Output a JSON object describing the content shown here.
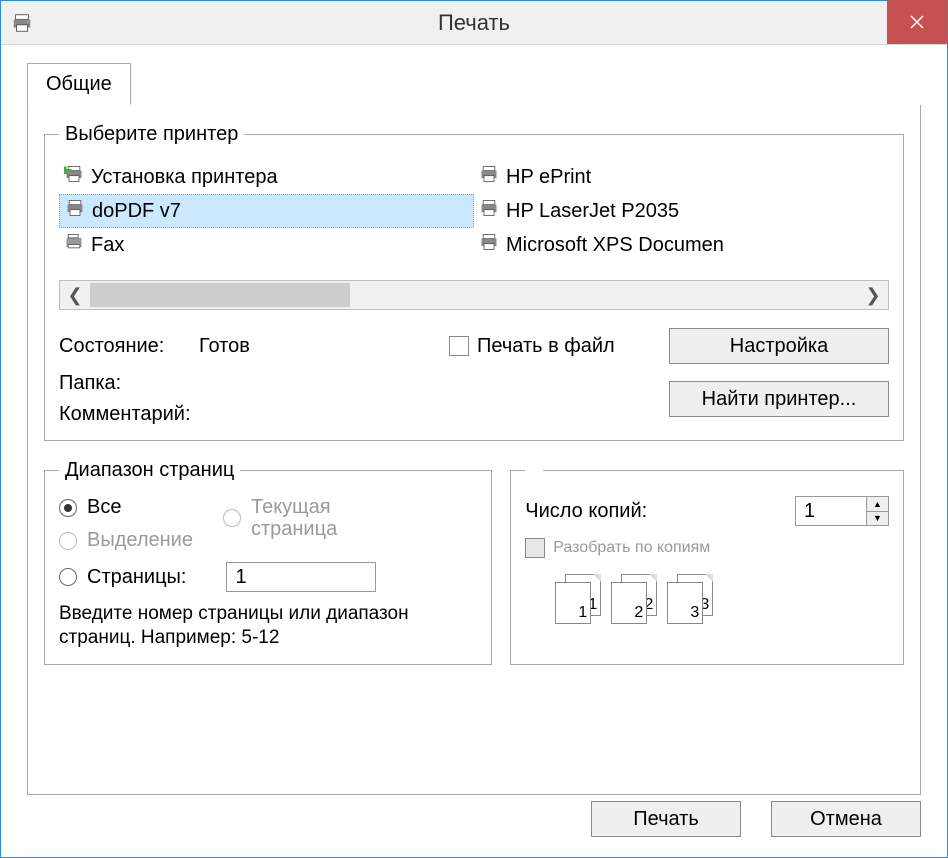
{
  "titlebar": {
    "title": "Печать"
  },
  "tabs": {
    "general": "Общие"
  },
  "printer_group": {
    "legend": "Выберите принтер",
    "items": [
      {
        "label": "Установка принтера"
      },
      {
        "label": "doPDF v7"
      },
      {
        "label": "Fax"
      },
      {
        "label": "HP ePrint"
      },
      {
        "label": "HP LaserJet P2035"
      },
      {
        "label": "Microsoft XPS Documen"
      }
    ]
  },
  "status": {
    "state_label": "Состояние:",
    "state_value": "Готов",
    "folder_label": "Папка:",
    "comment_label": "Комментарий:",
    "print_to_file": "Печать в файл",
    "preferences_btn": "Настройка",
    "find_printer_btn": "Найти принтер..."
  },
  "range": {
    "legend": "Диапазон страниц",
    "all": "Все",
    "current_page": "Текущая страница",
    "selection": "Выделение",
    "pages_label": "Страницы:",
    "pages_value": "1",
    "hint": "Введите номер страницы или диапазон страниц. Например: 5-12"
  },
  "copies": {
    "count_label": "Число копий:",
    "count_value": "1",
    "collate": "Разобрать по копиям",
    "seq": [
      "1",
      "1",
      "2",
      "2",
      "3",
      "3"
    ]
  },
  "buttons": {
    "print": "Печать",
    "cancel": "Отмена"
  }
}
